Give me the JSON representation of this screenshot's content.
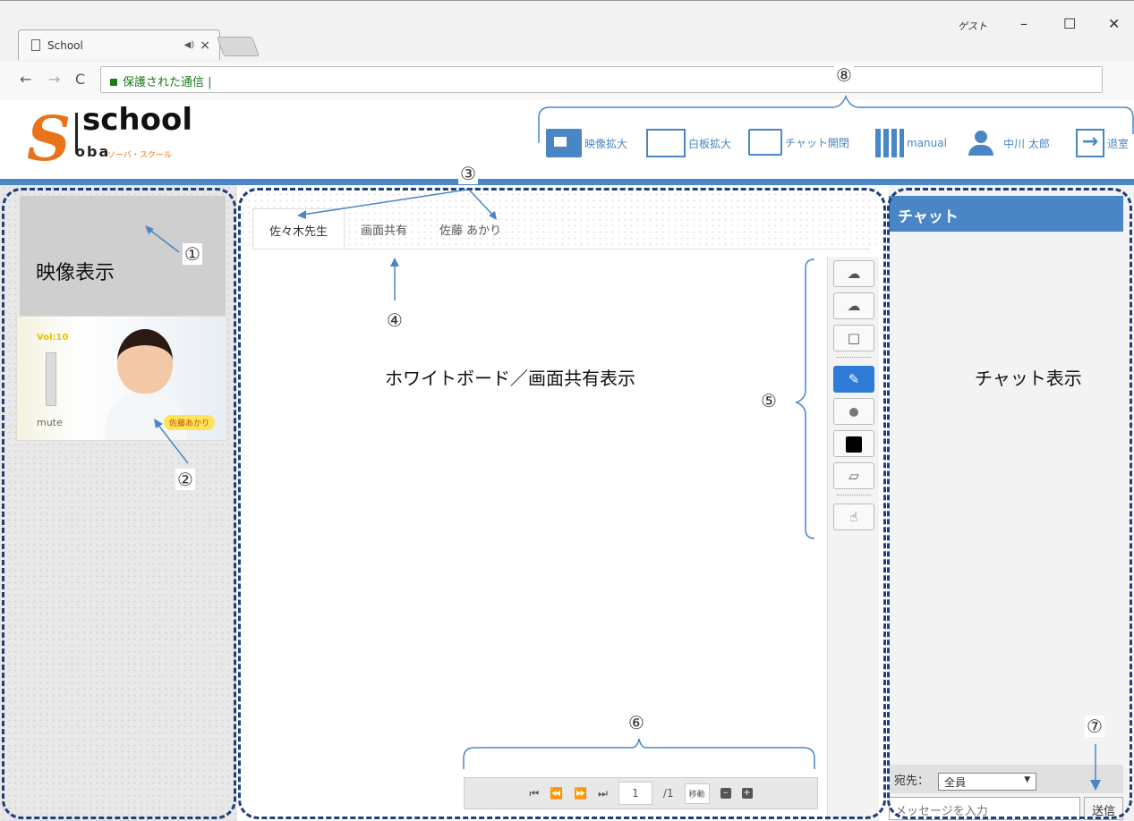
{
  "browser": {
    "tab_title": "School",
    "user_label": "ゲスト",
    "address_secure_label": "保護された通信"
  },
  "header": {
    "logo_text": "school",
    "logo_subtext": "ソーバ・スクール",
    "tools": [
      {
        "icon": "video-enlarge-icon",
        "label": "映像拡大"
      },
      {
        "icon": "whiteboard-enlarge-icon",
        "label": "白板拡大"
      },
      {
        "icon": "chat-toggle-icon",
        "label": "チャット開閉"
      },
      {
        "icon": "building-icon",
        "label": "manual"
      },
      {
        "icon": "user-icon",
        "label": "中川 太郎"
      },
      {
        "icon": "exit-icon",
        "label": "退室"
      }
    ]
  },
  "left_panel": {
    "video_label": "映像表示",
    "thumbnail": {
      "vol_label": "Vol:10",
      "mute_label": "mute",
      "name_tag": "佐藤あかり"
    }
  },
  "center": {
    "tabs": [
      "佐々木先生",
      "画面共有",
      "佐藤 あかり"
    ],
    "whiteboard_label": "ホワイトボード／画面共有表示",
    "toolbar": [
      "upload-icon",
      "download-icon",
      "sticky-note-icon",
      "pencil-icon",
      "pen-size-icon",
      "color-icon",
      "eraser-icon",
      "hand-pointer-icon"
    ],
    "pager": {
      "current_page": "1",
      "total_pages": "/1",
      "move_label": "移動"
    }
  },
  "chat": {
    "title": "チャット",
    "display_label": "チャット表示",
    "to_label": "宛先：",
    "to_value": "全員",
    "input_placeholder": "メッセージを入力",
    "send_label": "送信"
  },
  "annotations": {
    "n1": "①",
    "n2": "②",
    "n3": "③",
    "n4": "④",
    "n5": "⑤",
    "n6": "⑥",
    "n7": "⑦",
    "n8": "⑧"
  },
  "colors": {
    "accent": "#4a86c5",
    "brand_orange": "#e8731a",
    "annotation_border": "#1f3f7a",
    "active_tool": "#2f7bd8"
  }
}
